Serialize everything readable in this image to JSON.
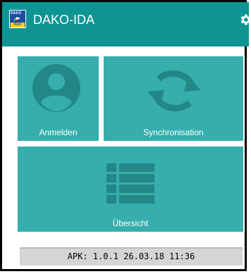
{
  "appbar": {
    "logo_top": "DAKO",
    "logo_bottom": "IDA",
    "title": "DAKO-IDA",
    "settings_icon": "gear-icon"
  },
  "tiles": {
    "login": {
      "label": "Anmelden",
      "icon": "user-avatar-icon"
    },
    "sync": {
      "label": "Synchronisation",
      "icon": "sync-icon"
    },
    "overview": {
      "label": "Übersicht",
      "icon": "list-icon"
    }
  },
  "status": {
    "text": "APK: 1.0.1 26.03.18 11:36"
  },
  "colors": {
    "appbar": "#0e9593",
    "tile": "#35aead",
    "tile_icon": "#228786",
    "status_bg": "#d5d5d5"
  }
}
